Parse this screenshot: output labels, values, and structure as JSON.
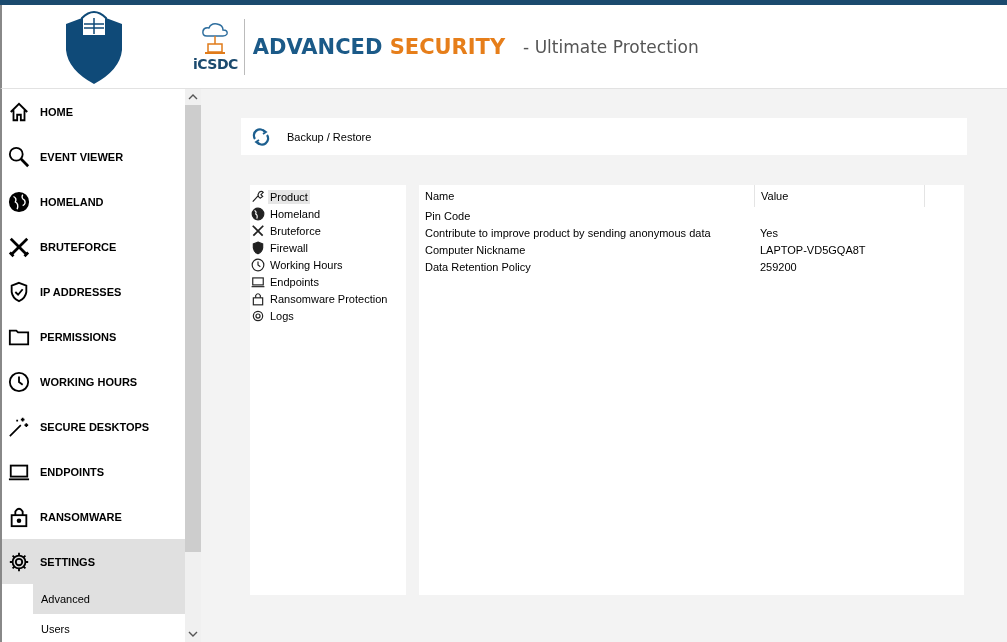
{
  "header": {
    "logo_text": "iCSDC",
    "brand_primary": "ADVANCED",
    "brand_secondary": "SECURITY",
    "tagline": "- Ultimate Protection"
  },
  "sidebar": {
    "items": [
      {
        "label": "HOME",
        "selected": false
      },
      {
        "label": "EVENT VIEWER",
        "selected": false
      },
      {
        "label": "HOMELAND",
        "selected": false
      },
      {
        "label": "BRUTEFORCE",
        "selected": false
      },
      {
        "label": "IP ADDRESSES",
        "selected": false
      },
      {
        "label": "PERMISSIONS",
        "selected": false
      },
      {
        "label": "WORKING HOURS",
        "selected": false
      },
      {
        "label": "SECURE DESKTOPS",
        "selected": false
      },
      {
        "label": "ENDPOINTS",
        "selected": false
      },
      {
        "label": "RANSOMWARE",
        "selected": false
      },
      {
        "label": "SETTINGS",
        "selected": true
      }
    ],
    "subitems": [
      {
        "label": "Advanced",
        "selected": true
      },
      {
        "label": "Users",
        "selected": false
      }
    ]
  },
  "toolbar": {
    "backup_label": "Backup / Restore"
  },
  "tree": {
    "items": [
      {
        "label": "Product",
        "selected": true
      },
      {
        "label": "Homeland",
        "selected": false
      },
      {
        "label": "Bruteforce",
        "selected": false
      },
      {
        "label": "Firewall",
        "selected": false
      },
      {
        "label": "Working Hours",
        "selected": false
      },
      {
        "label": "Endpoints",
        "selected": false
      },
      {
        "label": "Ransomware Protection",
        "selected": false
      },
      {
        "label": "Logs",
        "selected": false
      }
    ]
  },
  "table": {
    "columns": [
      "Name",
      "Value"
    ],
    "rows": [
      {
        "name": "Pin Code",
        "value": ""
      },
      {
        "name": "Contribute to improve product by sending anonymous data",
        "value": "Yes"
      },
      {
        "name": "Computer Nickname",
        "value": "LAPTOP-VD5GQA8T"
      },
      {
        "name": "Data Retention Policy",
        "value": "259200"
      }
    ]
  }
}
